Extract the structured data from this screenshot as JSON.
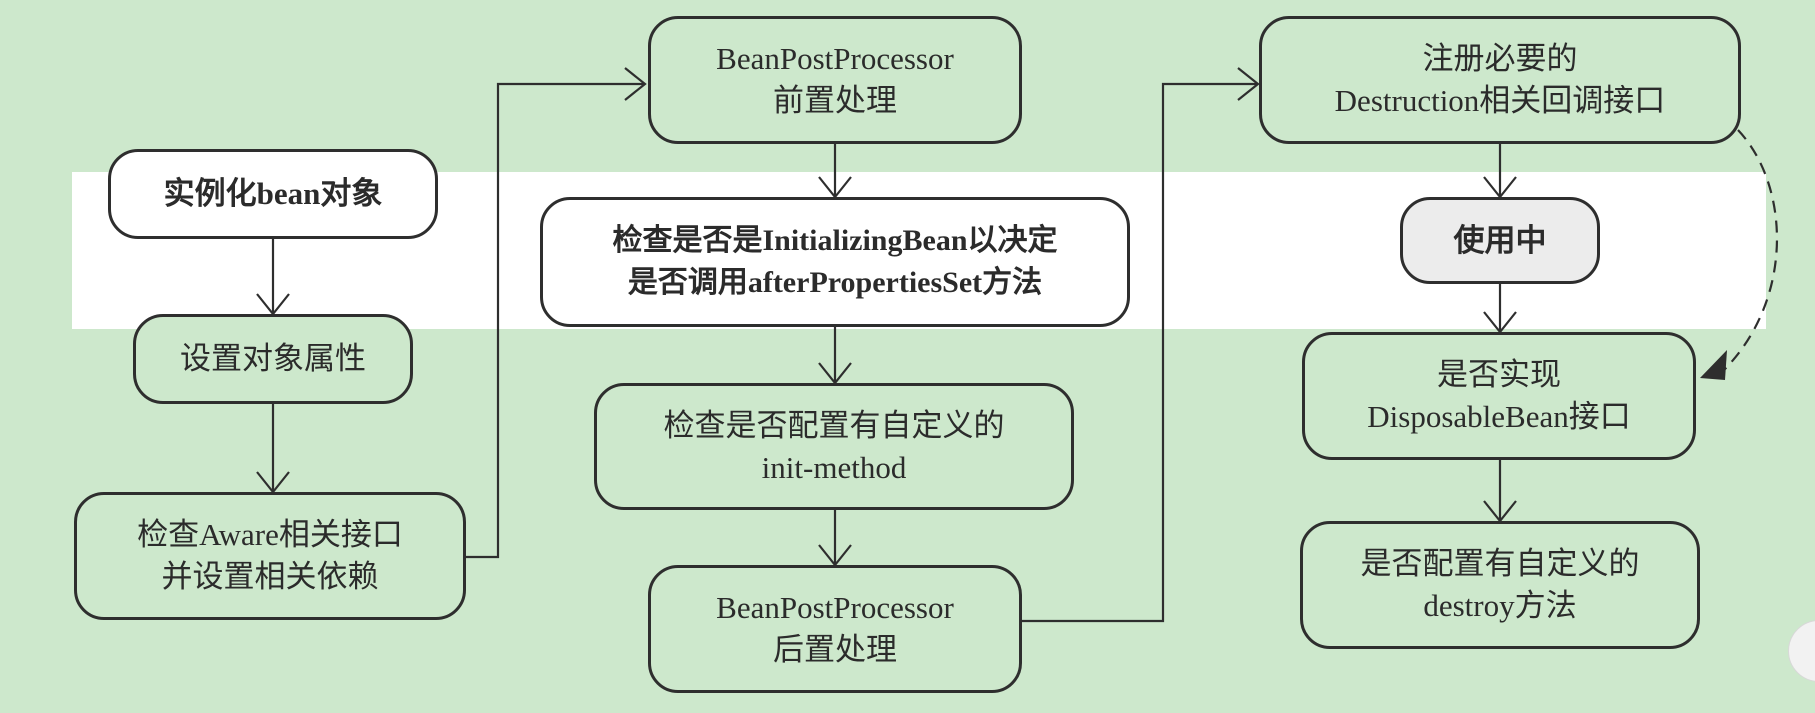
{
  "diagram": {
    "nodes": {
      "instantiate": {
        "lines": [
          "实例化bean对象"
        ]
      },
      "set_props": {
        "lines": [
          "设置对象属性"
        ]
      },
      "aware": {
        "lines": [
          "检查Aware相关接口",
          "并设置相关依赖"
        ]
      },
      "bpp_before": {
        "lines": [
          "BeanPostProcessor",
          "前置处理"
        ]
      },
      "initializing": {
        "lines": [
          "检查是否是InitializingBean以决定",
          "是否调用afterPropertiesSet方法"
        ]
      },
      "init_method": {
        "lines": [
          "检查是否配置有自定义的",
          "init-method"
        ]
      },
      "bpp_after": {
        "lines": [
          "BeanPostProcessor",
          "后置处理"
        ]
      },
      "destruction": {
        "lines": [
          "注册必要的",
          "Destruction相关回调接口"
        ]
      },
      "in_use": {
        "lines": [
          "使用中"
        ]
      },
      "disposable": {
        "lines": [
          "是否实现",
          "DisposableBean接口"
        ]
      },
      "destroy_method": {
        "lines": [
          "是否配置有自定义的",
          "destroy方法"
        ]
      }
    }
  },
  "colors": {
    "background": "#cde8cc",
    "band": "#ffffff",
    "border": "#2e2e2e",
    "text": "#2b2b2b",
    "grey_node": "#ececec"
  }
}
